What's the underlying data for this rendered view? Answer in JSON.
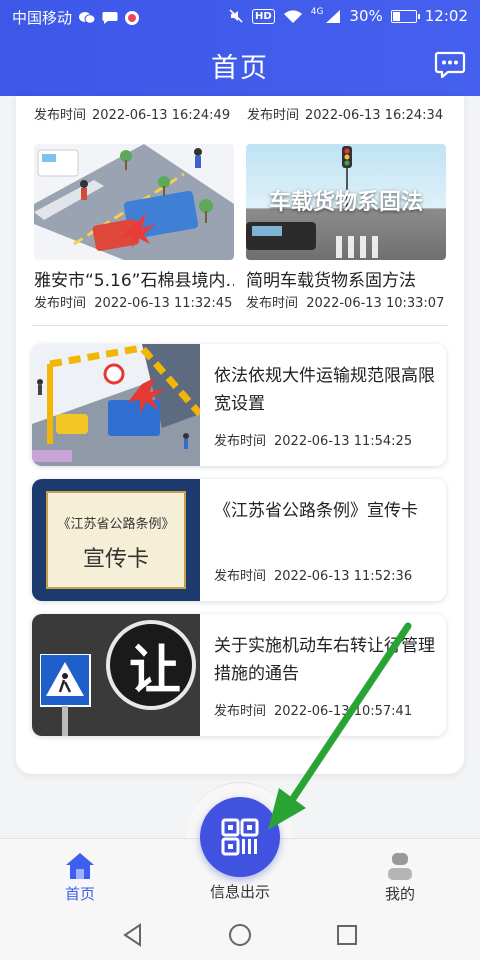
{
  "status_bar": {
    "carrier": "中国移动",
    "network": "4G",
    "hd": "HD",
    "battery_text": "30%",
    "battery_level": 0.3,
    "time": "12:02"
  },
  "header": {
    "title": "首页"
  },
  "publish_label": "发布时间",
  "top_row": [
    {
      "time": "2022-06-13 16:24:49"
    },
    {
      "time": "2022-06-13 16:24:34"
    }
  ],
  "grid": [
    {
      "title": "雅安市“5.16”石棉县境内…",
      "time": "2022-06-13 11:32:45"
    },
    {
      "title": "简明车载货物系固方法",
      "time": "2022-06-13 10:33:07",
      "thumb_text": "车载货物系固法"
    }
  ],
  "news": [
    {
      "title": "依法依规大件运输规范限高限宽设置",
      "time": "2022-06-13 11:54:25"
    },
    {
      "title": "《江苏省公路条例》宣传卡",
      "time": "2022-06-13 11:52:36",
      "thumb_line1": "《江苏省公路条例》",
      "thumb_line2": "宣传卡"
    },
    {
      "title": "关于实施机动车右转让行管理措施的通告",
      "time": "2022-06-13 10:57:41",
      "thumb_text": "让"
    }
  ],
  "bottom_nav": {
    "home": "首页",
    "info": "信息出示",
    "mine": "我的"
  },
  "colors": {
    "primary": "#4252e0",
    "header": "#3d57e8",
    "annotation_arrow": "#2aa335"
  }
}
